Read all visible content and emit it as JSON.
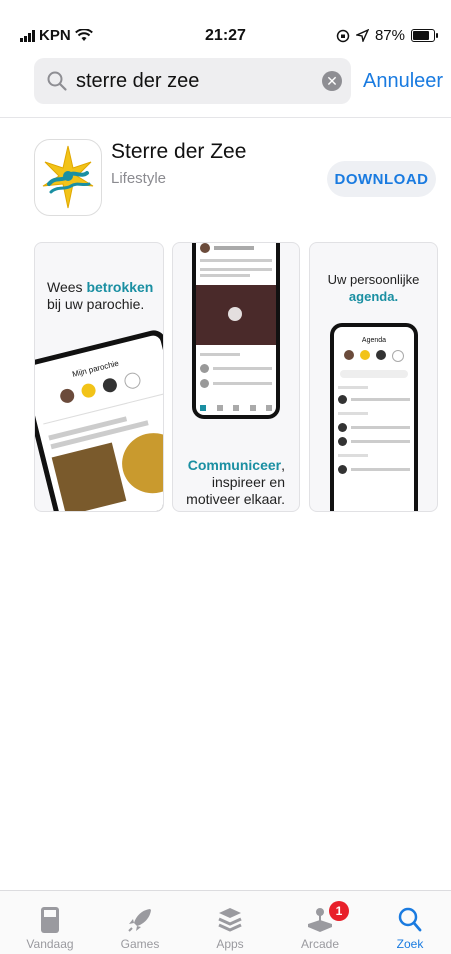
{
  "status": {
    "carrier": "KPN",
    "time": "21:27",
    "battery": "87%",
    "battery_level": 0.87
  },
  "search": {
    "query": "sterre der zee",
    "cancel_label": "Annuleer"
  },
  "app": {
    "name": "Sterre der Zee",
    "category": "Lifestyle",
    "download_label": "DOWNLOAD",
    "accent": "#1a8fa2"
  },
  "screenshots": {
    "shot1": {
      "line1": "Wees",
      "highlight": "betrokken",
      "line2": "bij uw parochie.",
      "phone_title": "Mijn parochie"
    },
    "shot2": {
      "highlight": "Communiceer",
      "line1": ",",
      "line2": "inspireer en",
      "line3": "motiveer elkaar."
    },
    "shot3": {
      "line1": "Uw persoonlijke",
      "highlight": "agenda",
      "dot": ".",
      "phone_title": "Agenda"
    }
  },
  "tabbar": {
    "items": [
      {
        "label": "Vandaag",
        "icon": "today-icon"
      },
      {
        "label": "Games",
        "icon": "rocket-icon"
      },
      {
        "label": "Apps",
        "icon": "layers-icon"
      },
      {
        "label": "Arcade",
        "icon": "joystick-icon",
        "badge": "1"
      },
      {
        "label": "Zoek",
        "icon": "search-icon",
        "active": true
      }
    ]
  }
}
